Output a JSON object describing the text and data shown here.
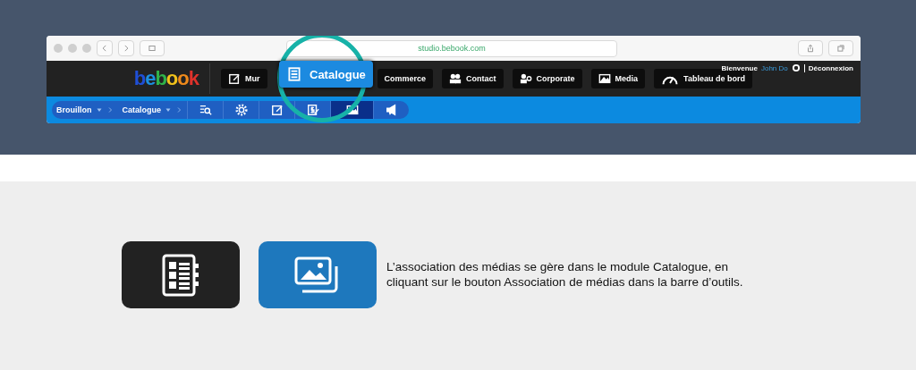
{
  "browser": {
    "url": "studio.bebook.com"
  },
  "header": {
    "logo": "bebook",
    "welcome": "Bienvenue",
    "user": "John Do",
    "logout": "Déconnexion"
  },
  "nav": [
    {
      "label": "Mur"
    },
    {
      "label": "Commerce"
    },
    {
      "label": "Contact"
    },
    {
      "label": "Corporate"
    },
    {
      "label": "Media"
    },
    {
      "label": "Tableau de bord"
    }
  ],
  "highlight": {
    "label": "Catalogue"
  },
  "breadcrumb": [
    {
      "label": "Brouillon"
    },
    {
      "label": "Catalogue"
    }
  ],
  "tools": [
    {
      "selected": false
    },
    {
      "selected": false
    },
    {
      "selected": false
    },
    {
      "selected": false
    },
    {
      "selected": true
    },
    {
      "selected": false
    }
  ],
  "tiles": [
    {
      "color": "#222222"
    },
    {
      "color": "#1e78bd"
    }
  ],
  "caption": "L’association des médias se gère dans le module Catalogue, en cliquant sur le bouton Association de médias dans la barre d’outils."
}
